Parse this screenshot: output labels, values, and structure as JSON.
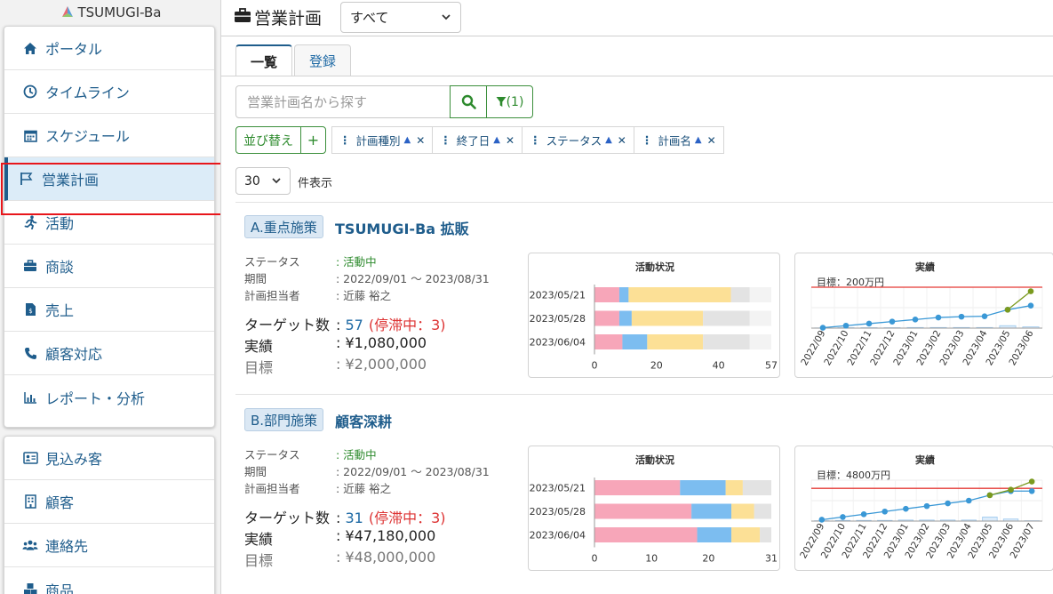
{
  "app": {
    "logo_text": "TSUMUGI-Ba"
  },
  "sidebar": {
    "group1": [
      {
        "label": "ポータル",
        "icon": "home-icon"
      },
      {
        "label": "タイムライン",
        "icon": "clock-icon"
      },
      {
        "label": "スケジュール",
        "icon": "calendar-icon"
      },
      {
        "label": "営業計画",
        "icon": "flag-icon",
        "active": true
      },
      {
        "label": "活動",
        "icon": "running-icon"
      },
      {
        "label": "商談",
        "icon": "briefcase-icon"
      },
      {
        "label": "売上",
        "icon": "invoice-icon"
      },
      {
        "label": "顧客対応",
        "icon": "phone-icon"
      },
      {
        "label": "レポート・分析",
        "icon": "bar-chart-icon"
      }
    ],
    "group2": [
      {
        "label": "見込み客",
        "icon": "id-card-icon"
      },
      {
        "label": "顧客",
        "icon": "building-icon"
      },
      {
        "label": "連絡先",
        "icon": "users-icon"
      },
      {
        "label": "商品",
        "icon": "boxes-icon"
      }
    ]
  },
  "header": {
    "title": "営業計画",
    "filter_value": "すべて"
  },
  "tabs": [
    {
      "label": "一覧",
      "active": true
    },
    {
      "label": "登録",
      "active": false
    }
  ],
  "search": {
    "placeholder": "営業計画名から探す",
    "filter_label": "(1)"
  },
  "sort": {
    "button_label": "並び替え",
    "add_label": "+",
    "chips": [
      "計画種別",
      "終了日",
      "ステータス",
      "計画名"
    ]
  },
  "pagination": {
    "per_page": "30",
    "label": "件表示"
  },
  "labels": {
    "status": "ステータス",
    "period": "期間",
    "owner": "計画担当者",
    "target": "ターゲット数",
    "actual": "実績",
    "goal": "目標",
    "activity_chart": "活動状況",
    "result_chart": "実績"
  },
  "plans": [
    {
      "badge": "A.重点施策",
      "name": "TSUMUGI-Ba 拡販",
      "status": ": 活動中",
      "period": ": 2022/09/01 ～ 2023/08/31",
      "owner": ": 近藤 裕之",
      "target_prefix": ": ",
      "target": "57",
      "stalled": "(停滞中：3)",
      "actual": ": ¥1,080,000",
      "goal": ": ¥2,000,000"
    },
    {
      "badge": "B.部門施策",
      "name": "顧客深耕",
      "status": ": 活動中",
      "period": ": 2022/09/01 ～ 2023/08/31",
      "owner": ": 近藤 裕之",
      "target_prefix": ": ",
      "target": "31",
      "stalled": "(停滞中：3)",
      "actual": ": ¥47,180,000",
      "goal": ": ¥48,000,000"
    }
  ],
  "chart_data": [
    {
      "type": "bar",
      "stacked": true,
      "orientation": "horizontal",
      "title": "活動状況",
      "categories": [
        "2023/05/21",
        "2023/05/28",
        "2023/06/04"
      ],
      "series": [
        {
          "color": "#f7a6b9",
          "values": [
            8,
            8,
            9
          ]
        },
        {
          "color": "#7cbdf0",
          "values": [
            3,
            4,
            8
          ]
        },
        {
          "color": "#fce096",
          "values": [
            33,
            23,
            18
          ]
        },
        {
          "color": "#e3e3e3",
          "values": [
            6,
            15,
            15
          ]
        }
      ],
      "xlim": [
        0,
        57
      ],
      "xticks": [
        0,
        20,
        40,
        57
      ]
    },
    {
      "type": "line",
      "title": "実績",
      "annotation": "目標：200万円",
      "target_color": "#e53935",
      "categories": [
        "2022/09",
        "2022/10",
        "2022/11",
        "2022/12",
        "2023/01",
        "2023/02",
        "2023/03",
        "2023/04",
        "2023/05",
        "2023/06"
      ],
      "series": [
        {
          "color": "#3a98d6",
          "values": [
            2,
            12,
            22,
            32,
            42,
            52,
            56,
            58,
            90,
            110
          ]
        },
        {
          "color": "#7a9a1e",
          "values": [
            null,
            null,
            null,
            null,
            null,
            null,
            null,
            null,
            90,
            180
          ]
        }
      ],
      "bars": [
        1,
        2,
        2,
        2,
        3,
        3,
        3,
        3,
        12,
        6
      ],
      "target": 200,
      "ylim": [
        0,
        200
      ]
    },
    {
      "type": "bar",
      "stacked": true,
      "orientation": "horizontal",
      "title": "活動状況",
      "categories": [
        "2023/05/21",
        "2023/05/28",
        "2023/06/04"
      ],
      "series": [
        {
          "color": "#f7a6b9",
          "values": [
            15,
            17,
            18
          ]
        },
        {
          "color": "#7cbdf0",
          "values": [
            8,
            7,
            6
          ]
        },
        {
          "color": "#fce096",
          "values": [
            3,
            4,
            5
          ]
        },
        {
          "color": "#e3e3e3",
          "values": [
            5,
            3,
            2
          ]
        }
      ],
      "xlim": [
        0,
        31
      ],
      "xticks": [
        0,
        10,
        20,
        31
      ]
    },
    {
      "type": "line",
      "title": "実績",
      "annotation": "目標：4800万円",
      "target_color": "#e53935",
      "categories": [
        "2022/09",
        "2022/10",
        "2022/11",
        "2022/12",
        "2023/01",
        "2023/02",
        "2023/03",
        "2023/04",
        "2023/05",
        "2023/06",
        "2023/07"
      ],
      "series": [
        {
          "color": "#3a98d6",
          "values": [
            200,
            600,
            1000,
            1400,
            1800,
            2200,
            2600,
            3000,
            3800,
            4400,
            4400
          ]
        },
        {
          "color": "#7a9a1e",
          "values": [
            null,
            null,
            null,
            null,
            null,
            null,
            null,
            null,
            3800,
            4600,
            5800
          ]
        }
      ],
      "bars": [
        50,
        100,
        100,
        100,
        150,
        150,
        150,
        150,
        600,
        300,
        50
      ],
      "target": 4800,
      "ylim": [
        0,
        6000
      ]
    }
  ]
}
